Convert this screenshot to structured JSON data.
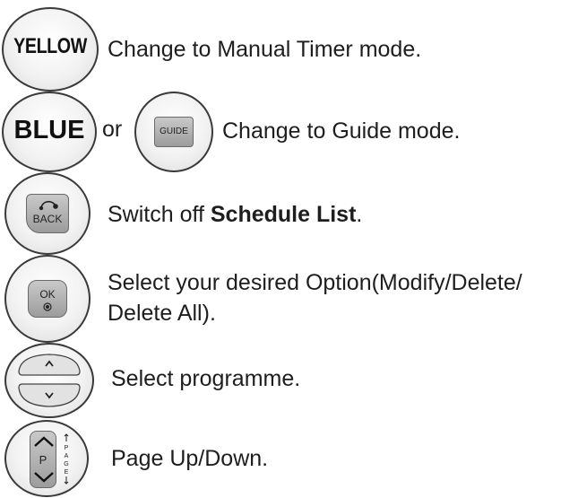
{
  "rows": [
    {
      "key_label": "YELLOW",
      "description": "Change to Manual Timer mode."
    },
    {
      "key_label": "BLUE",
      "connector": "or",
      "key2_label": "GUIDE",
      "description": "Change to Guide mode."
    },
    {
      "key_label": "BACK",
      "description_prefix": "Switch off ",
      "description_bold": "Schedule List",
      "description_suffix": "."
    },
    {
      "key_label": "OK",
      "description_line1": "Select your desired Option(Modify/Delete/",
      "description_line2": "Delete All)."
    },
    {
      "key_label_up": "^",
      "key_label_down": "v",
      "description": "Select programme."
    },
    {
      "key_label": "P",
      "key_side_label": "PAGE",
      "description": "Page Up/Down."
    }
  ],
  "icons": [
    "yellow-button-icon",
    "blue-button-icon",
    "guide-button-icon",
    "back-button-icon",
    "ok-button-icon",
    "channel-up-down-icon",
    "page-up-down-icon"
  ]
}
